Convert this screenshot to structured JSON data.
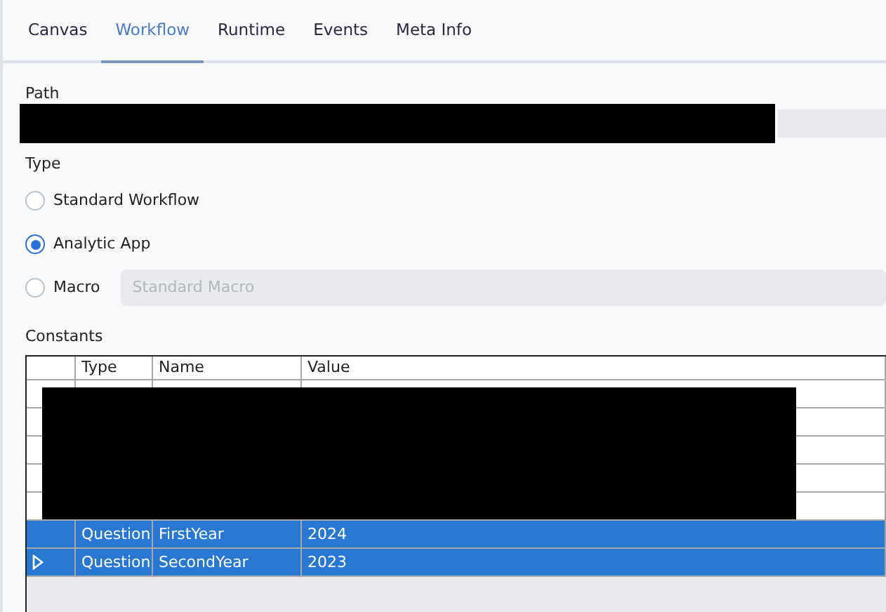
{
  "tabs": [
    {
      "label": "Canvas",
      "selected": false
    },
    {
      "label": "Workflow",
      "selected": true
    },
    {
      "label": "Runtime",
      "selected": false
    },
    {
      "label": "Events",
      "selected": false
    },
    {
      "label": "Meta Info",
      "selected": false
    }
  ],
  "path": {
    "label": "Path"
  },
  "type": {
    "label": "Type",
    "options": [
      {
        "label": "Standard Workflow",
        "selected": false,
        "checked": false
      },
      {
        "label": "Analytic App",
        "selected": false,
        "checked": true
      },
      {
        "label": "Macro",
        "selected": false,
        "checked": false,
        "dropdown": {
          "value": "Standard Macro",
          "disabled": true
        }
      }
    ]
  },
  "constants": {
    "label": "Constants",
    "columns": [
      "Type",
      "Name",
      "Value"
    ],
    "rows": [
      {
        "kind": "blank"
      },
      {
        "kind": "blank"
      },
      {
        "kind": "blank"
      },
      {
        "kind": "blank"
      },
      {
        "kind": "blank"
      },
      {
        "kind": "data",
        "selected": true,
        "current": false,
        "cells": [
          "Question",
          "FirstYear",
          "2024"
        ]
      },
      {
        "kind": "data",
        "selected": true,
        "current": true,
        "cells": [
          "Question",
          "SecondYear",
          "2023"
        ]
      }
    ]
  }
}
